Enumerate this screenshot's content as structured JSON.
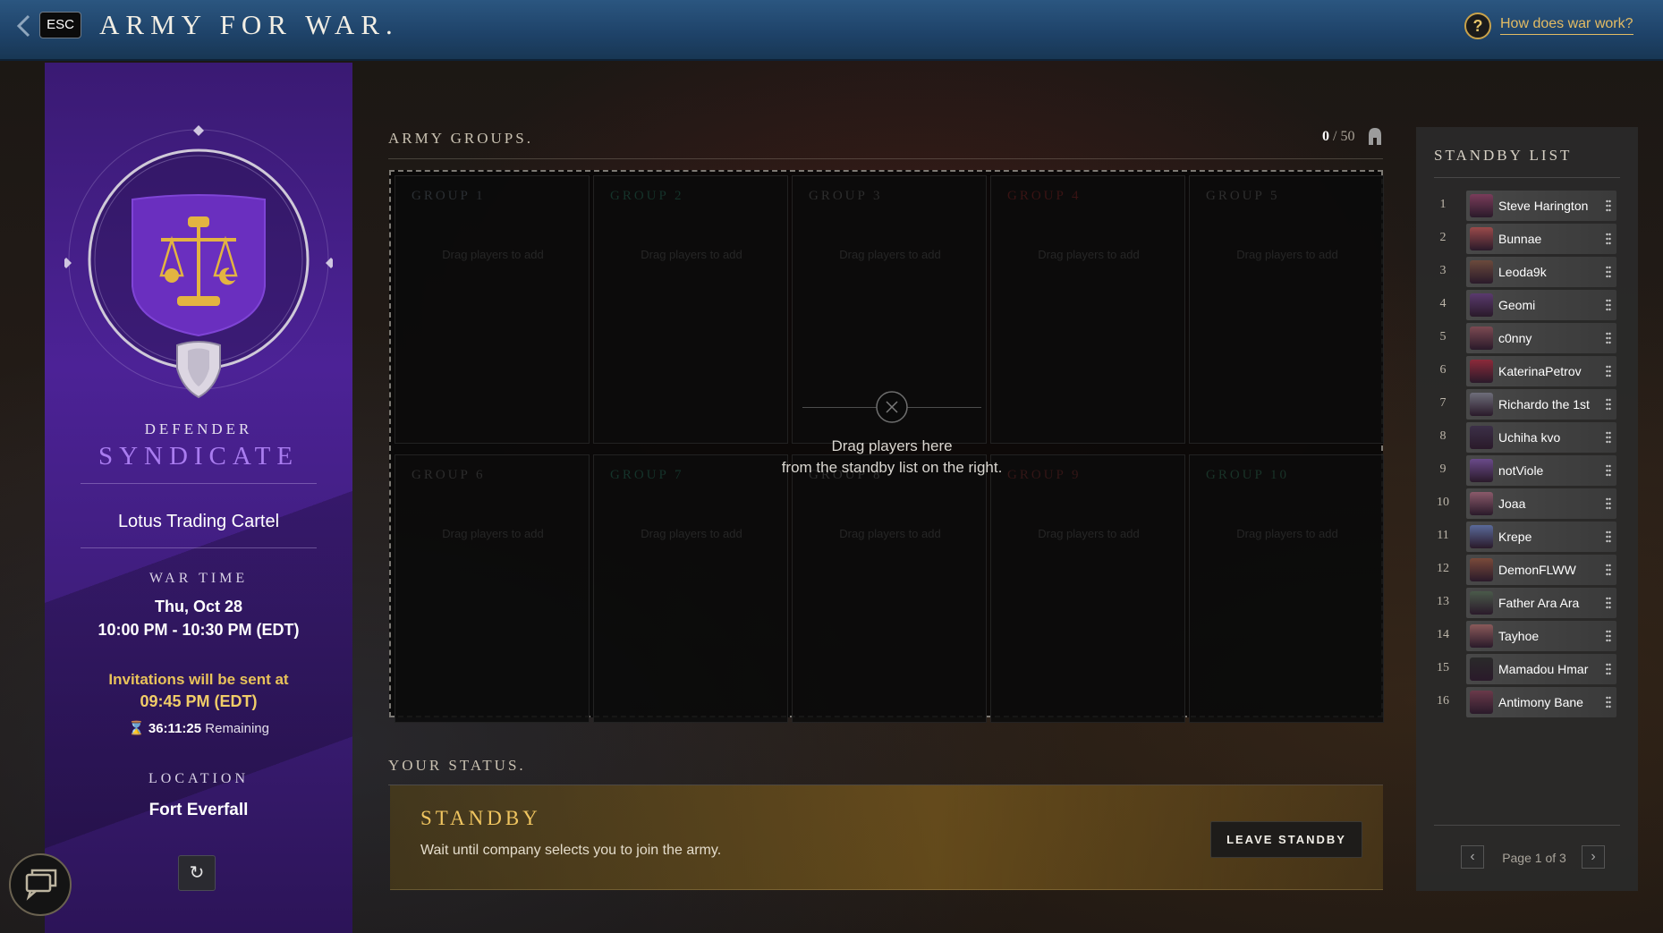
{
  "header": {
    "esc_label": "ESC",
    "title": "ARMY FOR WAR.",
    "help_icon": "?",
    "help_link": "How does war work?"
  },
  "faction": {
    "role": "DEFENDER",
    "name": "SYNDICATE",
    "company": "Lotus Trading Cartel",
    "war_time_label": "WAR TIME",
    "war_date": "Thu, Oct 28",
    "war_hours": "10:00 PM - 10:30 PM  (EDT)",
    "invite_text": "Invitations will be sent at",
    "invite_time": "09:45 PM  (EDT)",
    "remaining_time": "36:11:25",
    "remaining_label": "Remaining",
    "location_label": "LOCATION",
    "location": "Fort Everfall",
    "refresh_icon": "↻",
    "colors": {
      "panel": "#4c2296",
      "accent": "#a97cf0",
      "gold": "#e8c25a"
    }
  },
  "army": {
    "title": "ARMY GROUPS.",
    "count": "0",
    "max": "/ 50",
    "groups": [
      {
        "label": "GROUP 1",
        "hint": "Drag players to add",
        "color": "#2b2f33"
      },
      {
        "label": "GROUP 2",
        "hint": "Drag players to add",
        "color": "#15332a"
      },
      {
        "label": "GROUP 3",
        "hint": "Drag players to add",
        "color": "#2d2d2d"
      },
      {
        "label": "GROUP 4",
        "hint": "Drag players to add",
        "color": "#3a1414"
      },
      {
        "label": "GROUP 5",
        "hint": "Drag players to add",
        "color": "#2e2e2e"
      },
      {
        "label": "GROUP 6",
        "hint": "Drag players to add",
        "color": "#2c2c2c"
      },
      {
        "label": "GROUP 7",
        "hint": "Drag players to add",
        "color": "#15332a"
      },
      {
        "label": "GROUP 8",
        "hint": "Drag players to add",
        "color": "#2d2d2d"
      },
      {
        "label": "GROUP 9",
        "hint": "Drag players to add",
        "color": "#331616"
      },
      {
        "label": "GROUP 10",
        "hint": "Drag players to add",
        "color": "#193328"
      }
    ],
    "drop_line1": "Drag players here",
    "drop_line2": "from the standby list on the right."
  },
  "status": {
    "title": "YOUR STATUS.",
    "state": "STANDBY",
    "description": "Wait until company selects you to join the army.",
    "leave_button": "LEAVE STANDBY"
  },
  "standby": {
    "title": "STANDBY LIST",
    "players": [
      {
        "num": "1",
        "name": "Steve Harington"
      },
      {
        "num": "2",
        "name": "Bunnae"
      },
      {
        "num": "3",
        "name": "Leoda9k"
      },
      {
        "num": "4",
        "name": "Geomi"
      },
      {
        "num": "5",
        "name": "c0nny"
      },
      {
        "num": "6",
        "name": "KaterinaPetrov"
      },
      {
        "num": "7",
        "name": "Richardo the 1st"
      },
      {
        "num": "8",
        "name": "Uchiha kvo"
      },
      {
        "num": "9",
        "name": "notViole"
      },
      {
        "num": "10",
        "name": "Joaa"
      },
      {
        "num": "11",
        "name": "Krepe"
      },
      {
        "num": "12",
        "name": "DemonFLWW"
      },
      {
        "num": "13",
        "name": "Father Ara Ara"
      },
      {
        "num": "14",
        "name": "Tayhoe"
      },
      {
        "num": "15",
        "name": "Mamadou Hmar"
      },
      {
        "num": "16",
        "name": "Antimony Bane"
      }
    ],
    "page_label": "Page 1 of 3",
    "prev_icon": "‹",
    "next_icon": "›"
  }
}
